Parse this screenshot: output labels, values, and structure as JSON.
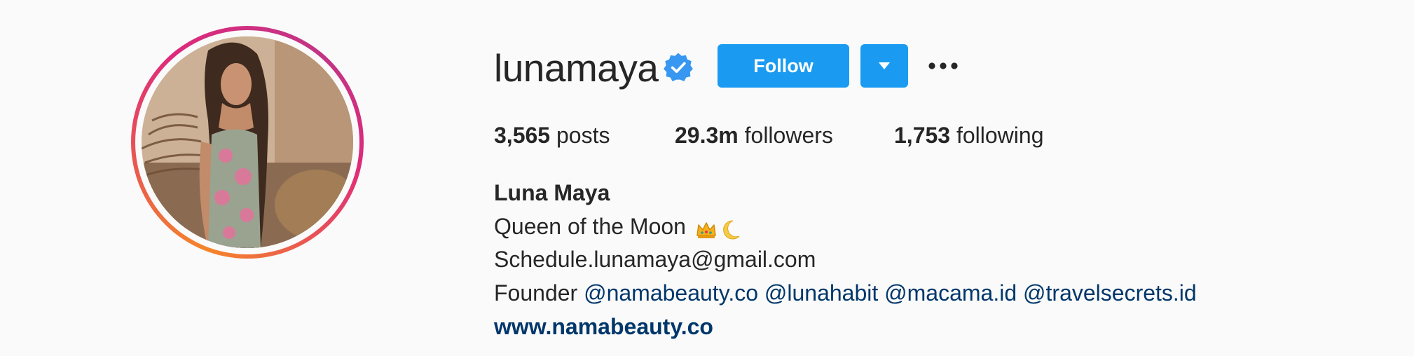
{
  "profile": {
    "username": "lunamaya",
    "verified_icon": "verified-badge-icon",
    "follow_label": "Follow",
    "dropdown_icon": "caret-down-icon",
    "more_icon": "more-options-icon"
  },
  "stats": {
    "posts_count": "3,565",
    "posts_label": "posts",
    "followers_count": "29.3m",
    "followers_label": "followers",
    "following_count": "1,753",
    "following_label": "following"
  },
  "bio": {
    "name": "Luna Maya",
    "tagline": "Queen of the Moon",
    "tagline_emojis": [
      "crown-emoji",
      "crescent-moon-emoji"
    ],
    "email": "Schedule.lunamaya@gmail.com",
    "founder_prefix": "Founder",
    "mentions": [
      "@namabeauty.co",
      "@lunahabit",
      "@macama.id",
      "@travelsecrets.id"
    ],
    "website": "www.namabeauty.co"
  },
  "colors": {
    "background": "#fafafa",
    "text": "#262626",
    "button_blue": "#1a9bf1",
    "link": "#00376b",
    "ring_orange": "#f58529",
    "ring_pink": "#dd2a7b",
    "verified_blue": "#3897f0"
  }
}
